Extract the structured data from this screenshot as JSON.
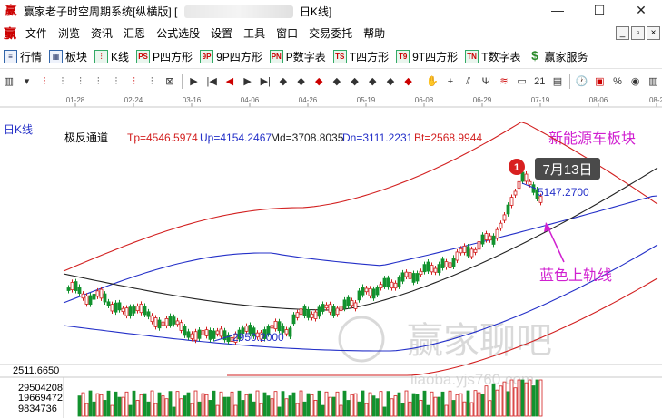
{
  "window": {
    "title_prefix": "赢家老子时空周期系统[纵横版]",
    "title_bracket_open": "[",
    "title_suffix": "日K线]",
    "minimize": "—",
    "maximize": "☐",
    "close": "✕"
  },
  "menu": {
    "logo": "赢",
    "items": [
      "文件",
      "浏览",
      "资讯",
      "汇恩",
      "公式选股",
      "设置",
      "工具",
      "窗口",
      "交易委托",
      "帮助"
    ],
    "mdi_min": "_",
    "mdi_restore": "▫",
    "mdi_close": "×"
  },
  "toolbar1": {
    "items": [
      {
        "label": "行情",
        "icon": "≡"
      },
      {
        "label": "板块",
        "icon": "▦"
      },
      {
        "label": "K线",
        "icon": "⫶"
      },
      {
        "label": "P四方形",
        "icon": "PS"
      },
      {
        "label": "9P四方形",
        "icon": "9P"
      },
      {
        "label": "P数字表",
        "icon": "PN"
      },
      {
        "label": "T四方形",
        "icon": "TS"
      },
      {
        "label": "9T四方形",
        "icon": "T9"
      },
      {
        "label": "T数字表",
        "icon": "TN"
      },
      {
        "label": "赢家服务",
        "icon": "$"
      }
    ]
  },
  "toolbar2": {
    "icons": [
      "▥",
      "▾",
      "⫶",
      "⫶",
      "⫶",
      "⫶",
      "⫶",
      "⫶",
      "⫶",
      "⊠",
      "▶",
      "|◀",
      "◀",
      "▶",
      "▶|",
      "◆",
      "◆",
      "◆",
      "◆",
      "◆",
      "◆",
      "◆",
      "◆",
      "✋",
      "+",
      "⫽",
      "Ψ",
      "≋",
      "▭",
      "21",
      "▤",
      "🕐",
      "▣",
      "%",
      "◉",
      "▥"
    ]
  },
  "chart": {
    "period_label": "日K线",
    "indicator_name": "极反通道",
    "tp": "Tp=4546.5974",
    "up": "Up=4154.2467",
    "md": "Md=3708.8035",
    "dn": "Dn=3111.2231",
    "bt": "Bt=2568.9944",
    "sector_title": "新能源车板块",
    "date_badge_num": "1",
    "date_badge_label": "7月13日",
    "peak_value": "5147.2700",
    "low_value": "2950.2000",
    "annotation": "蓝色上轨线",
    "vol_price_label": "2511.6650",
    "vol_levels": [
      "29504208",
      "19669472",
      "9834736"
    ],
    "watermark_main": "赢家聊吧",
    "watermark_url": "liaoba.yjs760.com",
    "date_ticks": [
      "01-28",
      "02-24",
      "03-16",
      "04-06",
      "04-26",
      "05-19",
      "06-08",
      "06-29",
      "07-19",
      "08-06",
      "08-2"
    ],
    "colors": {
      "red_band": "#d21f1f",
      "blue_band": "#2430c8",
      "mid_line": "#222222",
      "up_candle": "#d21f1f",
      "down_candle": "#12922e",
      "title_magenta": "#d020d0",
      "info_red": "#d21f1f",
      "info_blue": "#2430c8"
    }
  }
}
